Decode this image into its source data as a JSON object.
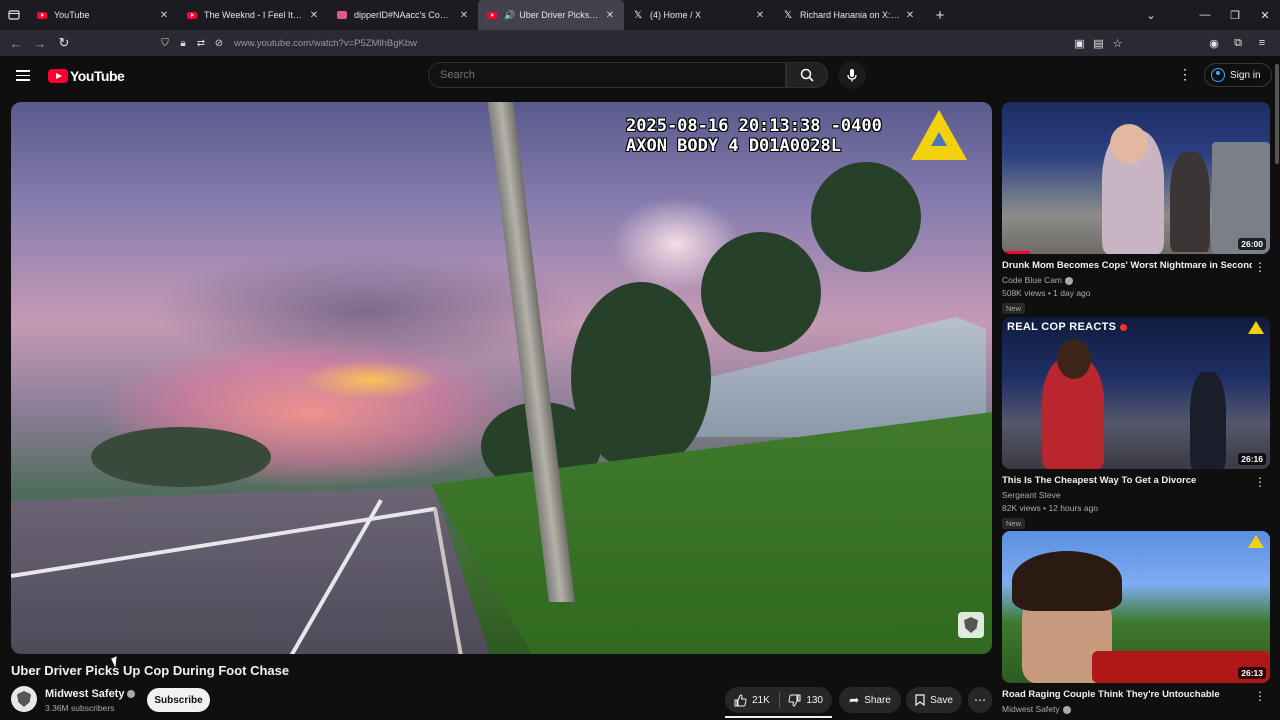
{
  "browser": {
    "tabs": [
      {
        "title": "YouTube",
        "icon": "youtube-icon"
      },
      {
        "title": "The Weeknd - I Feel It Coming",
        "icon": "youtube-icon"
      },
      {
        "title": "dipperID#NAacc's Competitive",
        "icon": "site-icon"
      },
      {
        "title": "Uber Driver Picks Up Cop D",
        "icon": "youtube-icon",
        "active": true,
        "audio": true
      },
      {
        "title": "(4) Home / X",
        "icon": "x-icon"
      },
      {
        "title": "Richard Hanania on X: \"😮https:",
        "icon": "x-icon"
      }
    ],
    "new_tab": "+",
    "url": "www.youtube.com/watch?v=P5ZMlhBgKbw",
    "window_controls": {
      "minimize": "—",
      "restore": "❐",
      "close": "✕"
    }
  },
  "header": {
    "logo_text": "YouTube",
    "search_placeholder": "Search",
    "sign_in": "Sign in"
  },
  "video": {
    "overlay_timestamp": "2025-08-16 20:13:38 -0400\nAXON BODY 4 D01A0028L",
    "title": "Uber Driver Picks Up Cop During Foot Chase",
    "channel": "Midwest Safety",
    "subscribers": "3.36M subscribers",
    "subscribe_label": "Subscribe",
    "likes": "21K",
    "dislikes": "130",
    "share_label": "Share",
    "save_label": "Save"
  },
  "recommendations": [
    {
      "title": "Drunk Mom Becomes Cops' Worst Nightmare in Seconds",
      "channel": "Code Blue Cam",
      "meta": "508K views • 1 day ago",
      "badge": "New",
      "duration": "26:00"
    },
    {
      "title": "This Is The Cheapest Way To Get a Divorce",
      "channel": "Sergeant Steve",
      "meta": "82K views • 12 hours ago",
      "badge": "New",
      "duration": "26:16",
      "thumb_text": "REAL COP REACTS"
    },
    {
      "title": "Road Raging Couple Think They're Untouchable",
      "channel": "Midwest Safety",
      "meta": "",
      "badge": "",
      "duration": "26:13"
    }
  ],
  "colors": {
    "accent": "#ff0033",
    "link": "#3ea6ff",
    "background": "#0f0f0f"
  }
}
